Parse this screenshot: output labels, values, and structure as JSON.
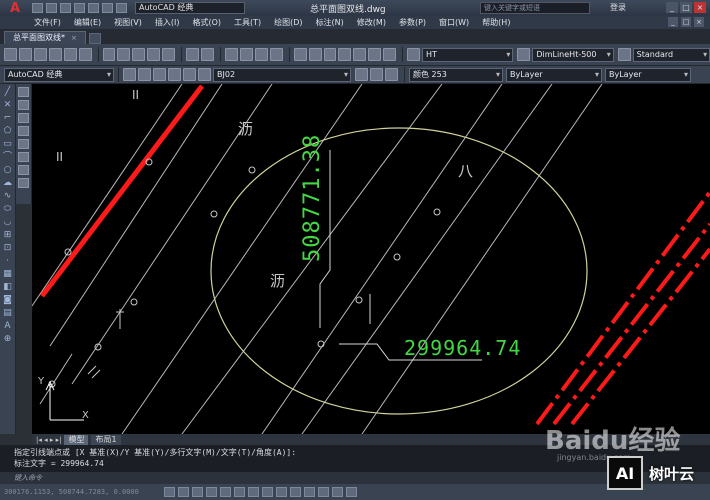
{
  "app": {
    "logo": "A",
    "workspace": "AutoCAD 经典",
    "document_title": "总平面图双线.dwg",
    "search_placeholder": "键入关键字或短语",
    "login": "登录"
  },
  "menu": [
    "文件(F)",
    "编辑(E)",
    "视图(V)",
    "插入(I)",
    "格式(O)",
    "工具(T)",
    "绘图(D)",
    "标注(N)",
    "修改(M)",
    "参数(P)",
    "窗口(W)",
    "帮助(H)"
  ],
  "doc_tab": {
    "label": "总平面图双线*",
    "close": "×"
  },
  "toolbar": {
    "text_style": "HT",
    "dim_style": "DimLineHt-500",
    "table_style": "Standard",
    "workspace2": "AutoCAD 经典",
    "layer": "BJ02",
    "color": "颜色 253",
    "linetype": "ByLayer",
    "lineweight": "ByLayer"
  },
  "canvas": {
    "dim_y": "508771.38",
    "dim_x": "299964.74",
    "label_li_1": "沥",
    "label_li_2": "沥",
    "label_ba": "八",
    "label_ii_1": "II",
    "label_ii_2": "II",
    "ucs_x": "X",
    "ucs_y": "Y"
  },
  "layout_tabs": {
    "nav": "|◂ ◂ ▸ ▸|",
    "model": "模型",
    "layout1": "布局1"
  },
  "command": {
    "line1": "指定引线端点或 [X 基准(X)/Y 基准(Y)/多行文字(M)/文字(T)/角度(A)]:",
    "line2": "标注文字 = 299964.74",
    "input_placeholder": "键入命令"
  },
  "status": {
    "coords": "300176.1153, 508744.7283, 0.0000"
  },
  "watermark": {
    "baidu": "Baidu经验",
    "baidu_url": "jingyan.baidu.com",
    "brand_box": "AI",
    "brand_text": "树叶云"
  }
}
